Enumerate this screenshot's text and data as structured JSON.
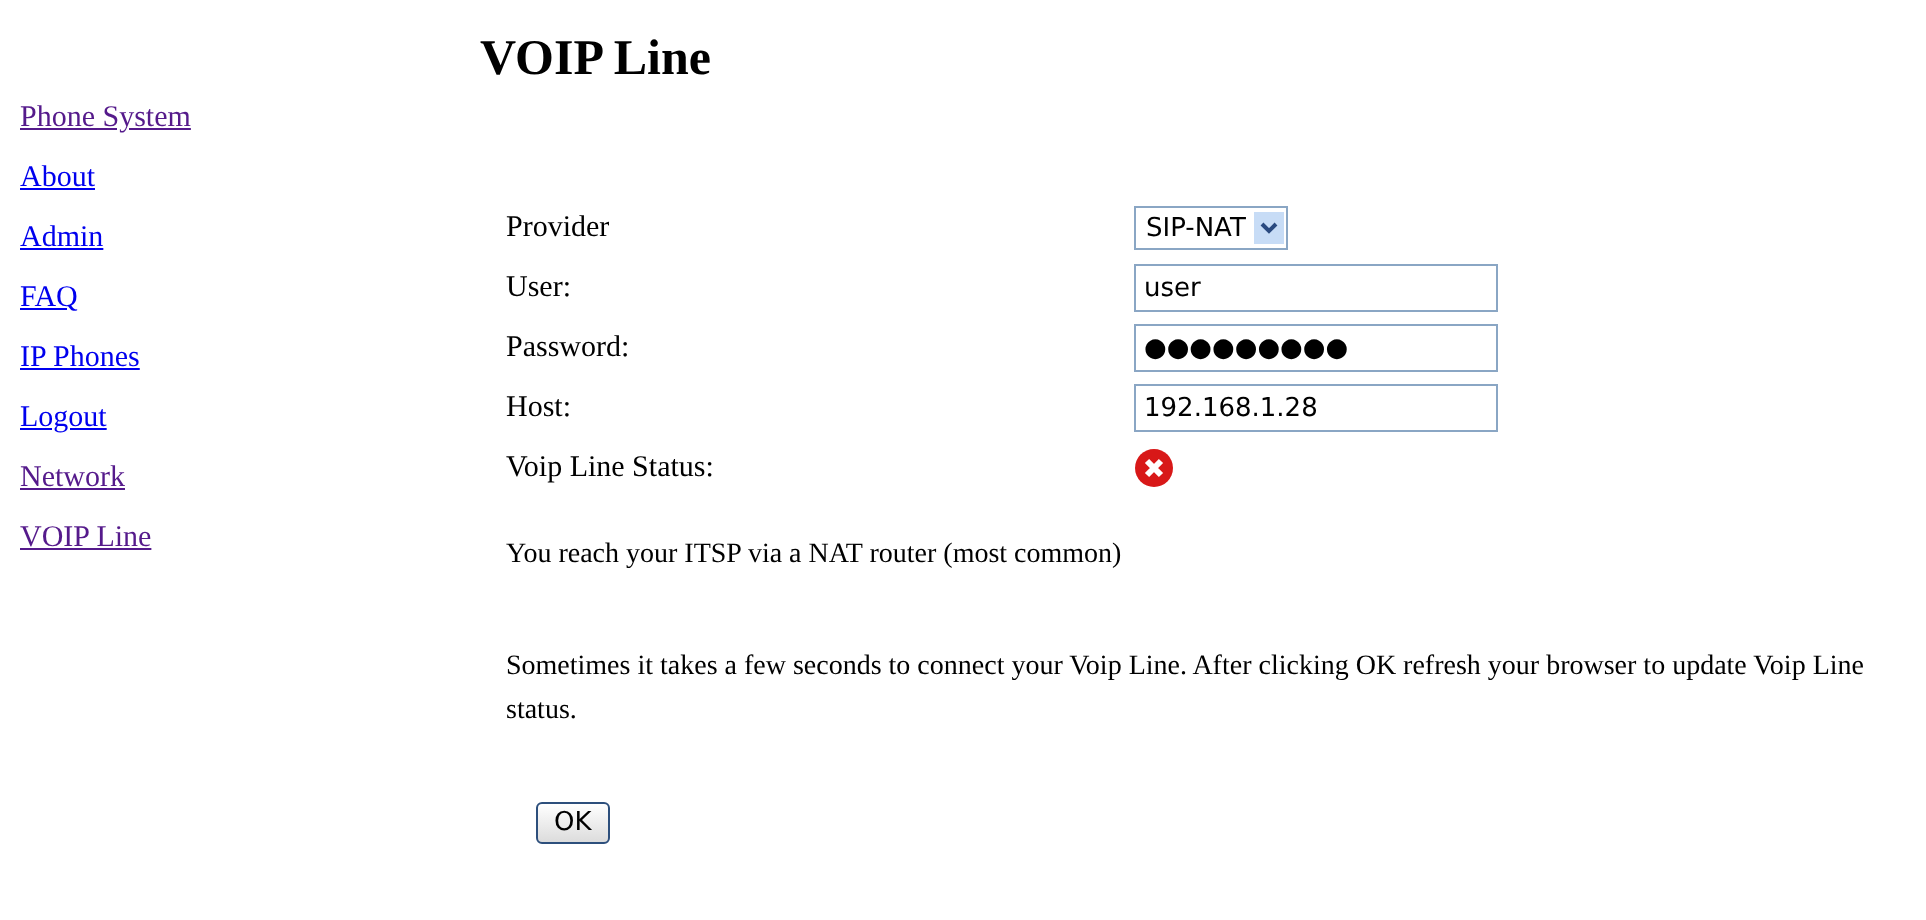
{
  "title": "VOIP Line",
  "sidebar": {
    "items": [
      {
        "label": "Phone System",
        "visited": true
      },
      {
        "label": "About",
        "visited": false
      },
      {
        "label": "Admin",
        "visited": false
      },
      {
        "label": "FAQ",
        "visited": false
      },
      {
        "label": "IP Phones",
        "visited": false
      },
      {
        "label": "Logout",
        "visited": false
      },
      {
        "label": "Network",
        "visited": true
      },
      {
        "label": "VOIP Line",
        "visited": true
      }
    ]
  },
  "form": {
    "rows": [
      {
        "kind": "select",
        "label": "Provider",
        "value": "SIP-NAT"
      },
      {
        "kind": "text",
        "label": "User:",
        "value": "user"
      },
      {
        "kind": "text",
        "label": "Password:",
        "value": "●●●●●●●●●"
      },
      {
        "kind": "text",
        "label": "Host:",
        "value": "192.168.1.28"
      },
      {
        "kind": "status",
        "label": "Voip Line Status:",
        "connected": false
      }
    ]
  },
  "paragraphs": [
    "You reach your ITSP via a NAT router (most common)",
    "Sometimes it takes a few seconds to connect your Voip Line. After clicking OK refresh your browser to update Voip Line status."
  ],
  "buttons": [
    "OK"
  ]
}
